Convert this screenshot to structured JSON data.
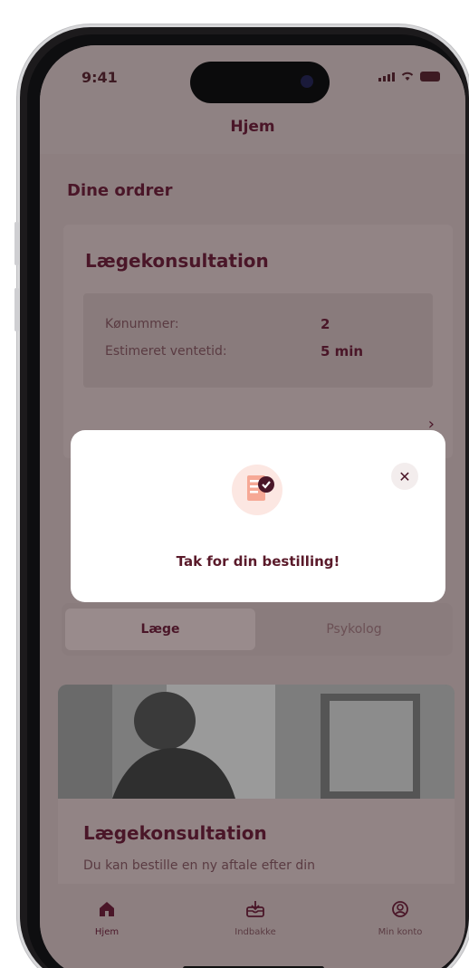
{
  "status_bar": {
    "time": "9:41"
  },
  "header": {
    "title": "Hjem"
  },
  "orders": {
    "section_title": "Dine ordrer",
    "card": {
      "title": "Lægekonsultation",
      "rows": [
        {
          "label": "Kønummer:",
          "value": "2"
        },
        {
          "label": "Estimeret ventetid:",
          "value": "5 min"
        }
      ]
    }
  },
  "toggle": {
    "options": [
      {
        "label": "Læge"
      },
      {
        "label": "Psykolog"
      }
    ]
  },
  "promo": {
    "title": "Lægekonsultation",
    "description": "Du kan bestille en ny aftale efter din"
  },
  "modal": {
    "message": "Tak for din bestilling!"
  },
  "tabbar": {
    "items": [
      {
        "label": "Hjem",
        "icon": "home-icon"
      },
      {
        "label": "Indbakke",
        "icon": "inbox-icon"
      },
      {
        "label": "Min konto",
        "icon": "account-icon"
      }
    ]
  },
  "colors": {
    "brand": "#4a1628",
    "overlay": "#8d7f80",
    "modal_bg": "#ffffff",
    "accent": "#e85a4f"
  }
}
